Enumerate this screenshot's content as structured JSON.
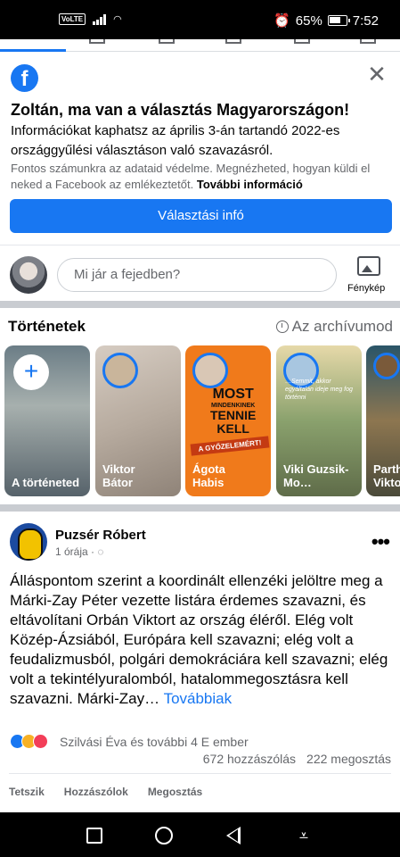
{
  "status_bar": {
    "volte": "VoLTE",
    "battery_percent": "65%",
    "time": "7:52"
  },
  "election_card": {
    "logo_letter": "f",
    "title": "Zoltán, ma van a választás Magyarországon!",
    "body": "Információkat kaphatsz az április 3-án tartandó 2022-es országgyűlési választáson való szavazásról.",
    "note": "Fontos számunkra az adataid védelme. Megnézheted, hogyan küldi el neked a Facebook az emlékeztetőt.",
    "note_link": "További információ",
    "button_label": "Választási infó",
    "close_symbol": "✕"
  },
  "composer": {
    "placeholder": "Mi jár a fejedben?",
    "photo_label": "Fénykép"
  },
  "stories": {
    "title": "Történetek",
    "archive_label": "Az archívumod",
    "items": [
      {
        "name": "A történeted"
      },
      {
        "name": "Viktor Bátor"
      },
      {
        "name": "Ágota Habis",
        "overlay_line1": "MOST",
        "overlay_line2": "MINDENKINEK",
        "overlay_line3": "TENNIE",
        "overlay_line4": "KELL",
        "ribbon": "A GYŐZELEMÉRT!"
      },
      {
        "name": "Viki Guzsik-Mo…",
        "overlay_quote": "…Semmit, akkor egyáltalán ideje meg fog történni"
      },
      {
        "name": "Parth Vikto"
      }
    ]
  },
  "post": {
    "author": "Puzsér Róbert",
    "time": "1 órája ·",
    "text": "Álláspontom szerint a koordinált ellenzéki jelöltre meg a Márki-Zay Péter vezette listára érdemes szavazni, és eltávolítani Orbán Viktort az ország éléről. Elég volt Közép-Ázsiából, Európára kell szavazni; elég volt a feudalizmusból, polgári demokráciára kell szavazni; elég volt a tekintélyuralomból, hatalommegosztásra kell szavazni. Márki-Zay…",
    "see_more": "Továbbiak",
    "reactions_text": "Szilvási Éva és további 4 E ember",
    "comments": "672 hozzászólás",
    "shares": "222 megosztás",
    "actions": [
      "Tetszik",
      "Hozzászólok",
      "Megosztás"
    ]
  },
  "colors": {
    "accent": "#1877f2",
    "separator": "#c9ccd1",
    "secondary_text": "#65676b"
  }
}
